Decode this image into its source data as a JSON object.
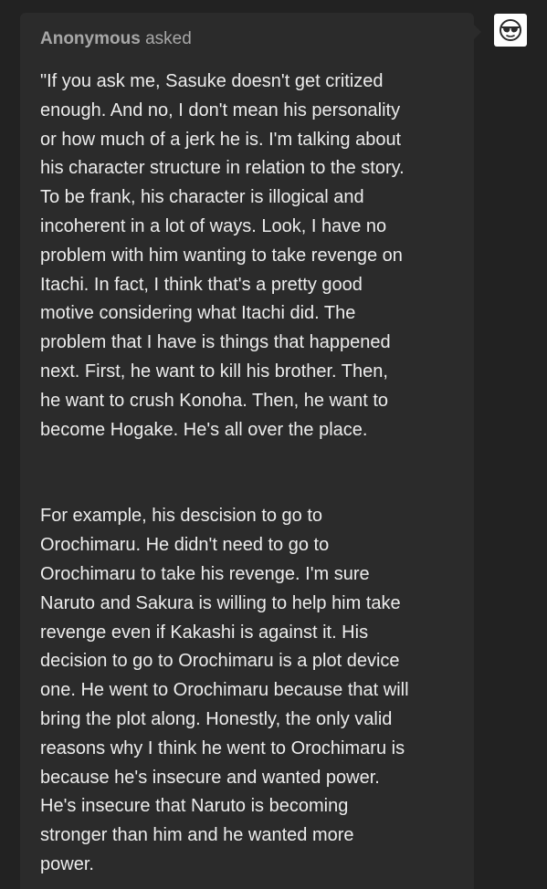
{
  "ask": {
    "asker_name": "Anonymous",
    "asked_label": "asked",
    "paragraphs": [
      "\"If you ask me, Sasuke doesn't get critized\nenough. And no, I don't mean his personality\nor how much of a jerk he is. I'm talking about\nhis character structure in relation to the story.\nTo be frank, his character is illogical and\nincoherent in a lot of ways. Look,  I have no\nproblem with him wanting to take revenge on\nItachi. In fact, I think that's a pretty good\nmotive considering what Itachi did. The\nproblem that I have is things that happened\nnext. First, he want to kill his brother. Then,\nhe want to crush Konoha. Then, he want to\nbecome Hogake. He's all over the place.",
      "For example, his descision to go to\nOrochimaru. He didn't need to go to\nOrochimaru to take his revenge. I'm sure\nNaruto and Sakura is willing to help him take\nrevenge even if Kakashi is against it. His\ndecision to go to Orochimaru is a plot device\none. He went to Orochimaru because that will\nbring the plot along. Honestly, the only valid\nreasons why I think he went to Orochimaru is\nbecause he's insecure and wanted power.\nHe's insecure that Naruto is becoming\nstronger than him and he wanted more\npower."
    ]
  },
  "avatar": {
    "icon": "sunglasses-face-icon"
  },
  "colors": {
    "page_background": "#222222",
    "card_background": "#2b2b2b",
    "header_text": "#a7a7a7",
    "body_text": "#ececec"
  }
}
